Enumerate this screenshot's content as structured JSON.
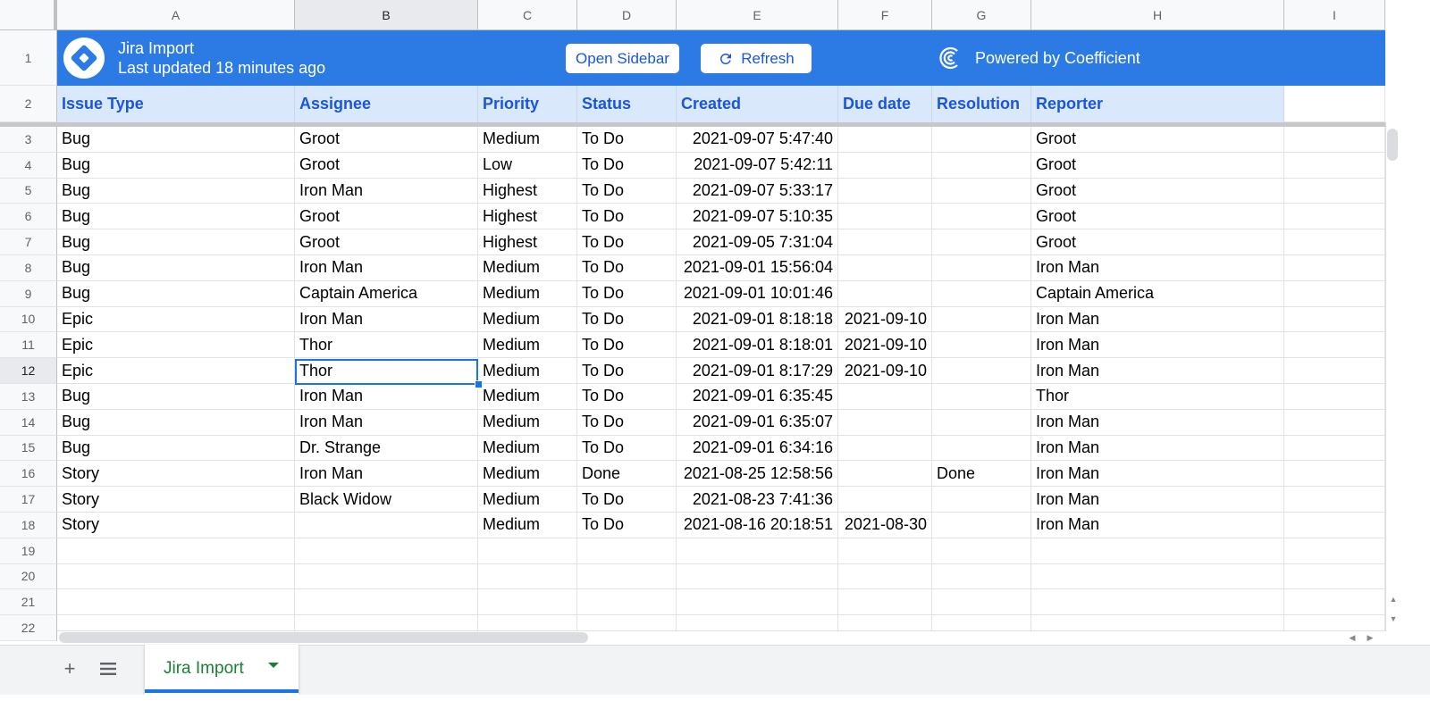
{
  "column_letters": [
    "A",
    "B",
    "C",
    "D",
    "E",
    "F",
    "G",
    "H",
    "I"
  ],
  "row_numbers": [
    "1",
    "2",
    "3",
    "4",
    "5",
    "6",
    "7",
    "8",
    "9",
    "10",
    "11",
    "12",
    "13",
    "14",
    "15",
    "16",
    "17",
    "18",
    "19",
    "20",
    "21",
    "22"
  ],
  "banner": {
    "title": "Jira Import",
    "subtitle": "Last updated 18 minutes ago",
    "open_sidebar_label": "Open Sidebar",
    "refresh_label": "Refresh",
    "powered_by": "Powered by Coefficient",
    "color": "#2c7be5"
  },
  "headers": [
    "Issue Type",
    "Assignee",
    "Priority",
    "Status",
    "Created",
    "Due date",
    "Resolution",
    "Reporter"
  ],
  "rows": [
    [
      "Bug",
      "Groot",
      "Medium",
      "To Do",
      "2021-09-07 5:47:40",
      "",
      "",
      "Groot"
    ],
    [
      "Bug",
      "Groot",
      "Low",
      "To Do",
      "2021-09-07 5:42:11",
      "",
      "",
      "Groot"
    ],
    [
      "Bug",
      "Iron Man",
      "Highest",
      "To Do",
      "2021-09-07 5:33:17",
      "",
      "",
      "Groot"
    ],
    [
      "Bug",
      "Groot",
      "Highest",
      "To Do",
      "2021-09-07 5:10:35",
      "",
      "",
      "Groot"
    ],
    [
      "Bug",
      "Groot",
      "Highest",
      "To Do",
      "2021-09-05 7:31:04",
      "",
      "",
      "Groot"
    ],
    [
      "Bug",
      "Iron Man",
      "Medium",
      "To Do",
      "2021-09-01 15:56:04",
      "",
      "",
      "Iron Man"
    ],
    [
      "Bug",
      "Captain America",
      "Medium",
      "To Do",
      "2021-09-01 10:01:46",
      "",
      "",
      "Captain America"
    ],
    [
      "Epic",
      "Iron Man",
      "Medium",
      "To Do",
      "2021-09-01 8:18:18",
      "2021-09-10",
      "",
      "Iron Man"
    ],
    [
      "Epic",
      "Thor",
      "Medium",
      "To Do",
      "2021-09-01 8:18:01",
      "2021-09-10",
      "",
      "Iron Man"
    ],
    [
      "Epic",
      "Thor",
      "Medium",
      "To Do",
      "2021-09-01 8:17:29",
      "2021-09-10",
      "",
      "Iron Man"
    ],
    [
      "Bug",
      "Iron Man",
      "Medium",
      "To Do",
      "2021-09-01 6:35:45",
      "",
      "",
      "Thor"
    ],
    [
      "Bug",
      "Iron Man",
      "Medium",
      "To Do",
      "2021-09-01 6:35:07",
      "",
      "",
      "Iron Man"
    ],
    [
      "Bug",
      "Dr. Strange",
      "Medium",
      "To Do",
      "2021-09-01 6:34:16",
      "",
      "",
      "Iron Man"
    ],
    [
      "Story",
      "Iron Man",
      "Medium",
      "Done",
      "2021-08-25 12:58:56",
      "",
      "Done",
      "Iron Man"
    ],
    [
      "Story",
      "Black Widow",
      "Medium",
      "To Do",
      "2021-08-23 7:41:36",
      "",
      "",
      "Iron Man"
    ],
    [
      "Story",
      "",
      "Medium",
      "To Do",
      "2021-08-16 20:18:51",
      "2021-08-30",
      "",
      "Iron Man"
    ]
  ],
  "selected_cell": "B12",
  "sheet_tab": {
    "label": "Jira Import",
    "color": "#188038"
  },
  "icons": {
    "add_sheet": "plus-icon",
    "all_sheets": "list-icon",
    "refresh": "refresh-icon",
    "logo": "jira-diamond-icon",
    "coefficient": "coefficient-logo-icon"
  }
}
